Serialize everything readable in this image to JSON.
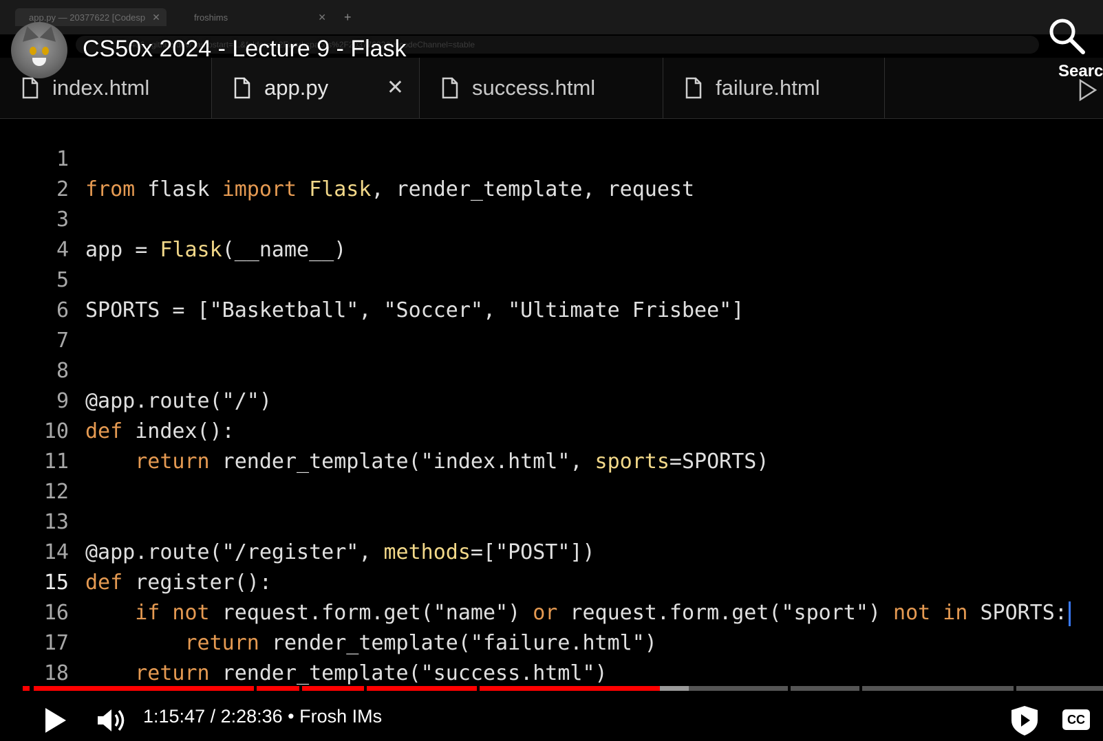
{
  "browser": {
    "tabs": [
      {
        "label": "app.py — 20377622 [Codesp"
      },
      {
        "label": "froshims"
      }
    ],
    "new_tab_symbol": "+",
    "address": "...4d6...github.dev/?autostart=...&folder=%2Fworkspaces%2F20377622&vscodeChannel=stable"
  },
  "overlay": {
    "video_title": "CS50x 2024 - Lecture 9 - Flask",
    "search_label": "Searc",
    "avatar": "channel-avatar-cat"
  },
  "editor": {
    "tabs": [
      {
        "label": "index.html",
        "active": false
      },
      {
        "label": "app.py",
        "active": true
      },
      {
        "label": "success.html",
        "active": false
      },
      {
        "label": "failure.html",
        "active": false
      }
    ],
    "close_symbol": "✕",
    "current_line": "15",
    "lines": [
      {
        "n": "1"
      },
      {
        "n": "2"
      },
      {
        "n": "3"
      },
      {
        "n": "4"
      },
      {
        "n": "5"
      },
      {
        "n": "6"
      },
      {
        "n": "7"
      },
      {
        "n": "8"
      },
      {
        "n": "9"
      },
      {
        "n": "10"
      },
      {
        "n": "11"
      },
      {
        "n": "12"
      },
      {
        "n": "13"
      },
      {
        "n": "14"
      },
      {
        "n": "15"
      },
      {
        "n": "16"
      },
      {
        "n": "17"
      },
      {
        "n": "18"
      }
    ],
    "code": {
      "l1": {
        "a": "from",
        "b": " flask ",
        "c": "import",
        "d": " Flask",
        "e": ", render_template, request"
      },
      "l3": {
        "a": "app = ",
        "b": "Flask",
        "c": "(__name__)"
      },
      "l5": {
        "a": "SPORTS = [\"Basketball\", \"Soccer\", \"Ultimate Frisbee\"]"
      },
      "l8": {
        "a": "@app.route(\"/\")"
      },
      "l9": {
        "a": "def",
        "b": " index():"
      },
      "l10": {
        "indent": "    ",
        "a": "return",
        "b": " render_template(\"index.html\", ",
        "c": "sports",
        "d": "=SPORTS)"
      },
      "l13": {
        "a": "@app.route(\"/register\", ",
        "b": "methods",
        "c": "=[\"POST\"])"
      },
      "l14": {
        "a": "def",
        "b": " register():"
      },
      "l15": {
        "indent": "    ",
        "a": "if not",
        "b": " request.form.get(\"name\") ",
        "c": "or",
        "d": " request.form.get(\"sport\") ",
        "e": "not in",
        "f": " SPORTS:"
      },
      "l16": {
        "indent": "        ",
        "a": "return",
        "b": " render_template(\"failure.html\")"
      },
      "l17": {
        "indent": "    ",
        "a": "return",
        "b": " render_template(\"success.html\")"
      }
    }
  },
  "player": {
    "current_time": "1:15:47",
    "duration": "2:28:36",
    "time_display": "1:15:47 / 2:28:36 • Frosh IMs",
    "chapter": "Frosh IMs",
    "progress_fraction": 0.51,
    "cc_label": "CC",
    "accent_color": "#ff0000"
  }
}
